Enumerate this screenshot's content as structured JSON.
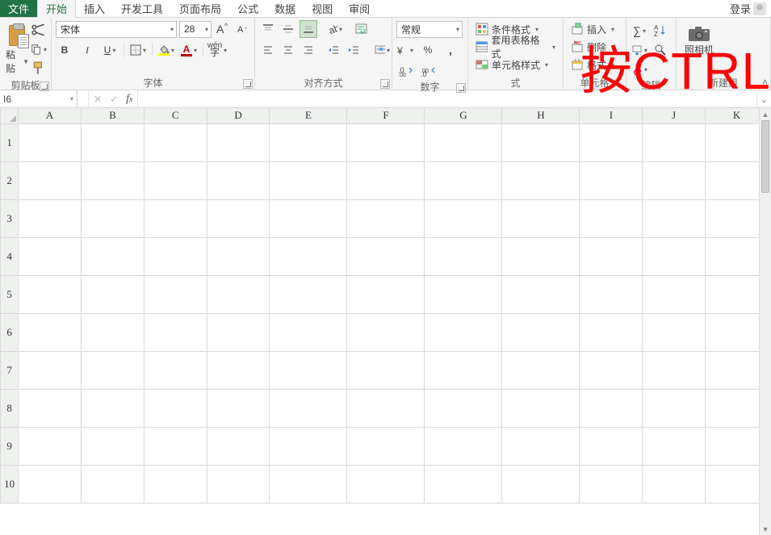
{
  "tabs": {
    "file": "文件",
    "items": [
      "开始",
      "插入",
      "开发工具",
      "页面布局",
      "公式",
      "数据",
      "视图",
      "审阅"
    ],
    "active_index": 0,
    "login": "登录"
  },
  "ribbon": {
    "clipboard": {
      "paste": "粘贴",
      "label": "剪贴板"
    },
    "font": {
      "name": "宋体",
      "size": "28",
      "label": "字体"
    },
    "align": {
      "label": "对齐方式"
    },
    "number": {
      "format": "常规",
      "label": "数字"
    },
    "styles": {
      "cond_format": "条件格式",
      "table_format": "套用表格格式",
      "cell_styles": "单元格样式",
      "short": "式"
    },
    "cells": {
      "insert": "插入",
      "delete": "删除",
      "format": "格式",
      "label": "单元格"
    },
    "editing": {
      "label": "编辑"
    },
    "camera": {
      "label": "照相机",
      "group_label": "新建组"
    }
  },
  "overlay": "按CTRL",
  "formula_bar": {
    "name_box": "I6",
    "formula": ""
  },
  "columns": [
    "A",
    "B",
    "C",
    "D",
    "E",
    "F",
    "G",
    "H",
    "I",
    "J",
    "K"
  ],
  "rows": [
    "1",
    "2",
    "3",
    "4",
    "5",
    "6",
    "7",
    "8",
    "9",
    "10"
  ]
}
